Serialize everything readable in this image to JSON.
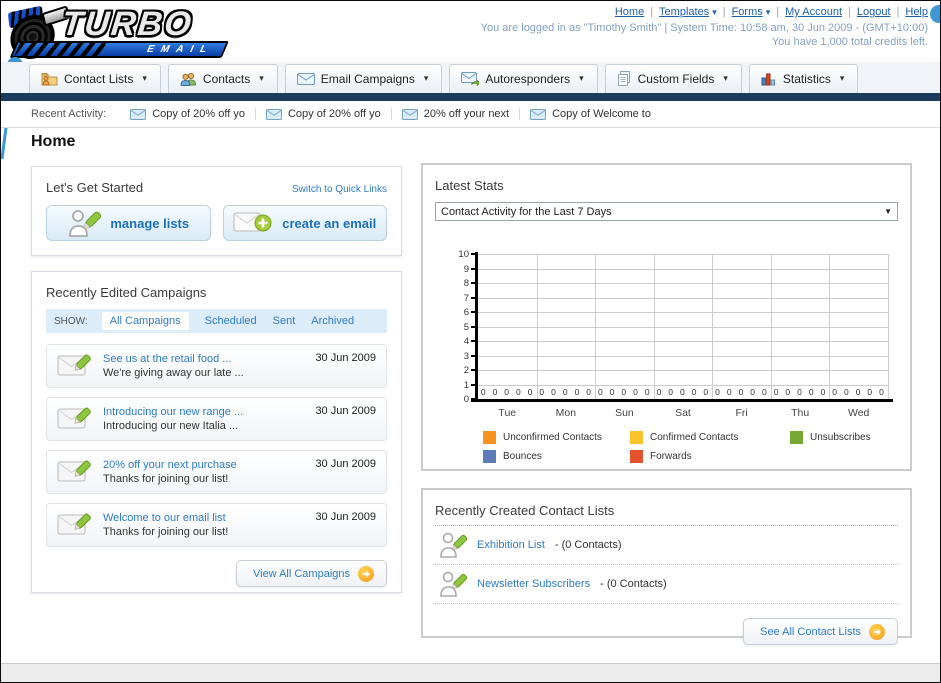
{
  "header": {
    "logo_line1": "TURBO",
    "logo_line2": "EMAIL",
    "nav_links": [
      {
        "label": "Home",
        "dropdown": false
      },
      {
        "label": "Templates",
        "dropdown": true
      },
      {
        "label": "Forms",
        "dropdown": true
      },
      {
        "label": "My Account",
        "dropdown": false
      },
      {
        "label": "Logout",
        "dropdown": false
      },
      {
        "label": "Help",
        "dropdown": false
      }
    ],
    "login_status": "You are logged in as \"Timothy Smith\" | System Time: 10:58 am, 30 Jun 2009 - (GMT+10:00)",
    "credits": "You have 1,000 total credits left."
  },
  "tabs": [
    {
      "label": "Contact Lists",
      "icon": "contact-lists-folder-icon"
    },
    {
      "label": "Contacts",
      "icon": "contacts-icon"
    },
    {
      "label": "Email Campaigns",
      "icon": "email-icon"
    },
    {
      "label": "Autoresponders",
      "icon": "autoresponder-icon"
    },
    {
      "label": "Custom Fields",
      "icon": "custom-fields-icon"
    },
    {
      "label": "Statistics",
      "icon": "statistics-icon"
    }
  ],
  "recent_activity": {
    "label": "Recent Activity:",
    "items": [
      "Copy of 20% off yo",
      "Copy of 20% off yo",
      "20% off your next",
      "Copy of Welcome to"
    ]
  },
  "page_title": "Home",
  "get_started": {
    "title": "Let's Get Started",
    "switch_link": "Switch to Quick Links",
    "buttons": [
      {
        "label": "manage lists",
        "icon": "manage-lists-icon"
      },
      {
        "label": "create an email",
        "icon": "create-email-icon"
      }
    ]
  },
  "campaigns": {
    "title": "Recently Edited Campaigns",
    "show_label": "SHOW:",
    "filters": [
      "All Campaigns",
      "Scheduled",
      "Sent",
      "Archived"
    ],
    "active_filter": "All Campaigns",
    "items": [
      {
        "title": "See us at the retail food ...",
        "subtitle": "We're giving away our late ...",
        "date": "30 Jun 2009"
      },
      {
        "title": "Introducing our new range ...",
        "subtitle": "Introducing our new Italia ...",
        "date": "30 Jun 2009"
      },
      {
        "title": "20% off your next purchase",
        "subtitle": "Thanks for joining our list!",
        "date": "30 Jun 2009"
      },
      {
        "title": "Welcome to our email list",
        "subtitle": "Thanks for joining our list!",
        "date": "30 Jun 2009"
      }
    ],
    "view_all": "View All Campaigns"
  },
  "stats": {
    "title": "Latest Stats",
    "dropdown_value": "Contact Activity for the Last 7 Days",
    "chart_data": {
      "type": "bar",
      "title": "Contact Activity for the Last 7 Days",
      "categories": [
        "Tue",
        "Mon",
        "Sun",
        "Sat",
        "Fri",
        "Thu",
        "Wed"
      ],
      "series": [
        {
          "name": "Unconfirmed Contacts",
          "color": "#F6921E",
          "values": [
            0,
            0,
            0,
            0,
            0,
            0,
            0
          ]
        },
        {
          "name": "Confirmed Contacts",
          "color": "#F8C32B",
          "values": [
            0,
            0,
            0,
            0,
            0,
            0,
            0
          ]
        },
        {
          "name": "Unsubscribes",
          "color": "#77A933",
          "values": [
            0,
            0,
            0,
            0,
            0,
            0,
            0
          ]
        },
        {
          "name": "Bounces",
          "color": "#5B7CB9",
          "values": [
            0,
            0,
            0,
            0,
            0,
            0,
            0
          ]
        },
        {
          "name": "Forwards",
          "color": "#E5502D",
          "values": [
            0,
            0,
            0,
            0,
            0,
            0,
            0
          ]
        }
      ],
      "ylim": [
        0,
        10
      ],
      "yticks": [
        0,
        1,
        2,
        3,
        4,
        5,
        6,
        7,
        8,
        9,
        10
      ],
      "grid": true,
      "legend_position": "bottom"
    }
  },
  "contact_lists": {
    "title": "Recently Created Contact Lists",
    "items": [
      {
        "name": "Exhibition List",
        "suffix": "- (0 Contacts)"
      },
      {
        "name": "Newsletter Subscribers",
        "suffix": "- (0 Contacts)"
      }
    ],
    "see_all": "See All Contact Lists"
  },
  "colors": {
    "navy_bar": "#1c3c5e",
    "link_blue": "#2f7cc0",
    "annotation_blue": "#3e97d4"
  }
}
